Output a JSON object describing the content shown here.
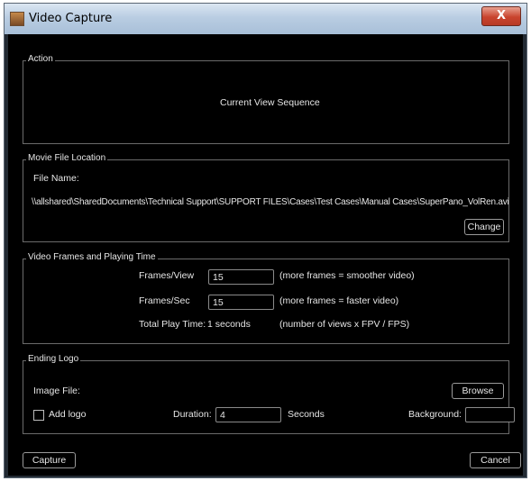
{
  "window": {
    "title": "Video Capture",
    "close_glyph": "X"
  },
  "action": {
    "legend": "Action",
    "text": "Current View Sequence"
  },
  "movie": {
    "legend": "Movie File Location",
    "file_name_label": "File Name:",
    "path": "\\\\allshared\\SharedDocuments\\Technical Support\\SUPPORT FILES\\Cases\\Test Cases\\Manual Cases\\SuperPano_VolRen.avi",
    "change_label": "Change"
  },
  "frames": {
    "legend": "Video Frames and Playing Time",
    "fpv_label": "Frames/View",
    "fpv_value": "15",
    "fpv_hint": "(more frames = smoother video)",
    "fps_label": "Frames/Sec",
    "fps_value": "15",
    "fps_hint": "(more frames = faster video)",
    "total_label": "Total Play Time:",
    "total_value": "1 seconds",
    "total_hint": "(number of views x FPV / FPS)"
  },
  "logo": {
    "legend": "Ending Logo",
    "image_file_label": "Image File:",
    "browse_label": "Browse",
    "add_logo_label": "Add logo",
    "add_logo_checked": false,
    "duration_label": "Duration:",
    "duration_value": "4",
    "seconds_label": "Seconds",
    "background_label": "Background:",
    "background_color": "#000000"
  },
  "footer": {
    "capture_label": "Capture",
    "cancel_label": "Cancel"
  }
}
